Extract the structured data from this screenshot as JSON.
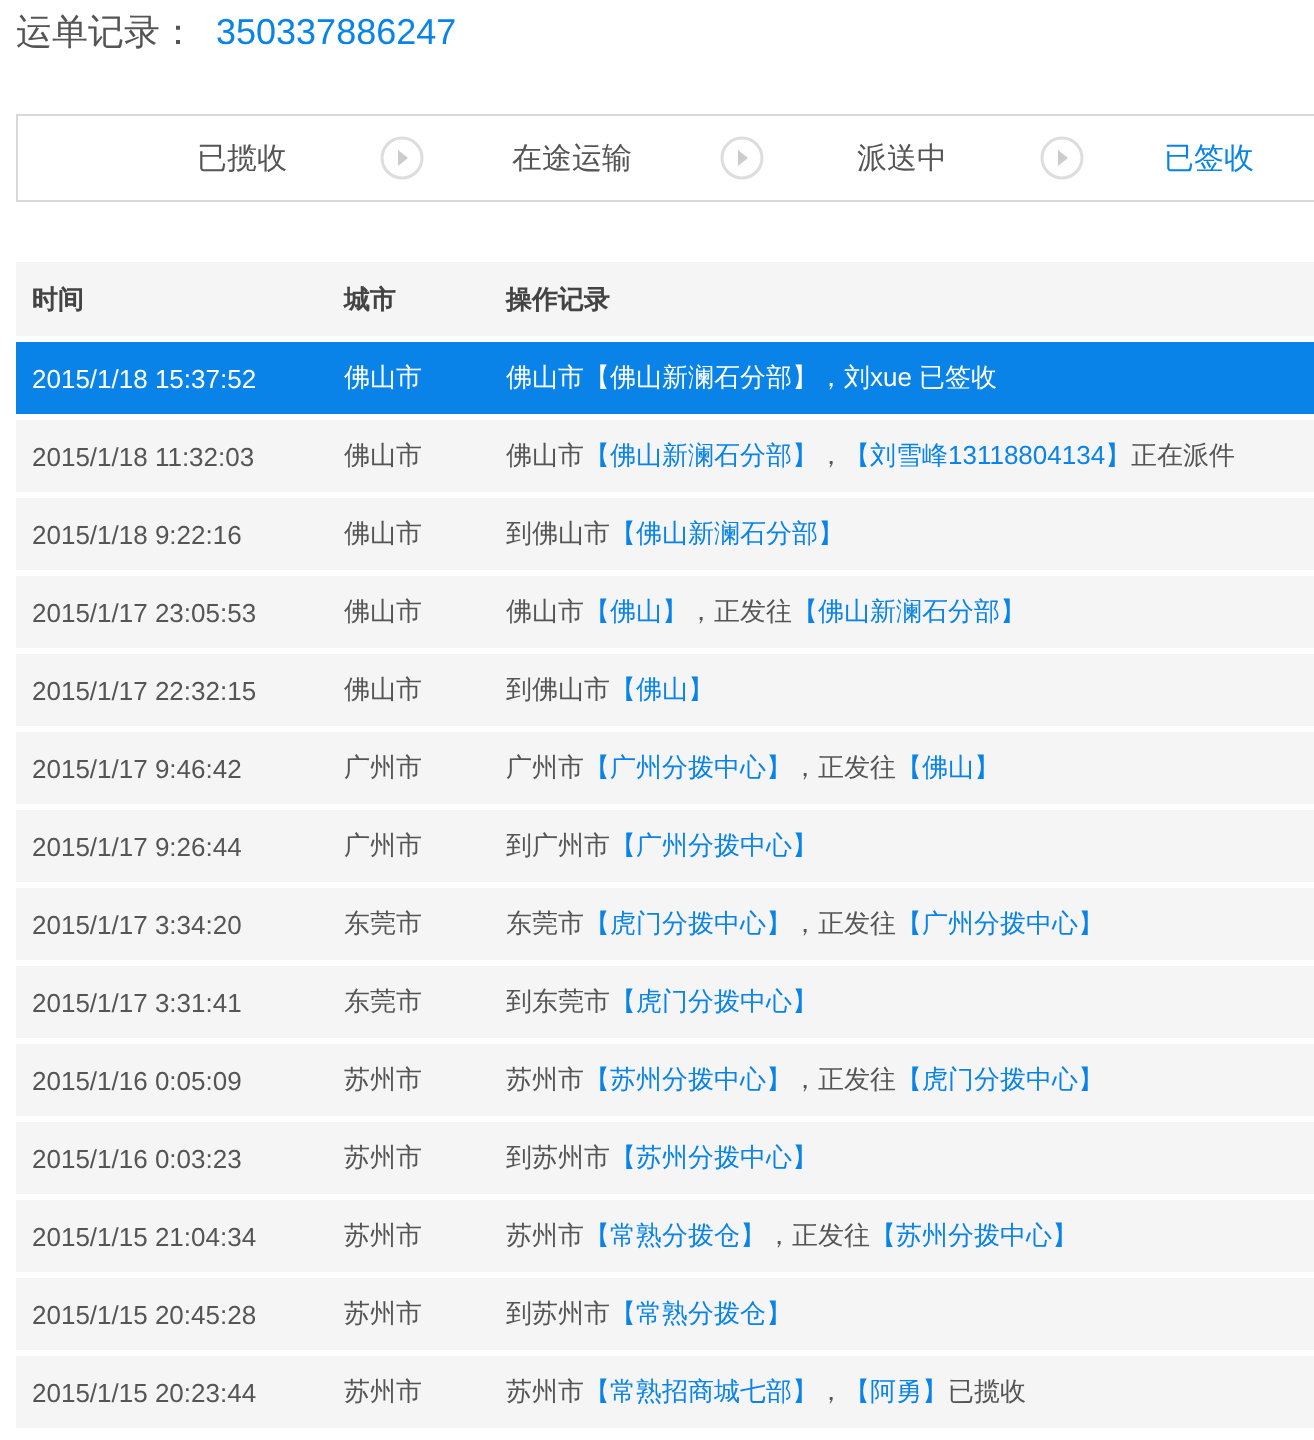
{
  "header": {
    "label": "运单记录：",
    "tracking_number": "350337886247"
  },
  "steps": [
    {
      "label": "已揽收",
      "selected": false
    },
    {
      "label": "在途运输",
      "selected": false
    },
    {
      "label": "派送中",
      "selected": false
    },
    {
      "label": "已签收",
      "selected": true
    }
  ],
  "table": {
    "columns": [
      "时间",
      "城市",
      "操作记录"
    ],
    "rows": [
      {
        "time": "2015/1/18 15:37:52",
        "city": "佛山市",
        "selected": true,
        "record": [
          {
            "text": "佛山市【佛山新澜石分部】，刘xue 已签收"
          }
        ]
      },
      {
        "time": "2015/1/18 11:32:03",
        "city": "佛山市",
        "selected": false,
        "record": [
          {
            "text": "佛山市",
            "highlight": false
          },
          {
            "text": "【佛山新澜石分部】",
            "highlight": true
          },
          {
            "text": "，",
            "highlight": false
          },
          {
            "text": "【刘雪峰13118804134】",
            "highlight": true
          },
          {
            "text": "正在派件",
            "highlight": false
          }
        ]
      },
      {
        "time": "2015/1/18 9:22:16",
        "city": "佛山市",
        "selected": false,
        "record": [
          {
            "text": "到佛山市",
            "highlight": false
          },
          {
            "text": "【佛山新澜石分部】",
            "highlight": true
          }
        ]
      },
      {
        "time": "2015/1/17 23:05:53",
        "city": "佛山市",
        "selected": false,
        "record": [
          {
            "text": "佛山市",
            "highlight": false
          },
          {
            "text": "【佛山】",
            "highlight": true
          },
          {
            "text": "，正发往",
            "highlight": false
          },
          {
            "text": "【佛山新澜石分部】",
            "highlight": true
          }
        ]
      },
      {
        "time": "2015/1/17 22:32:15",
        "city": "佛山市",
        "selected": false,
        "record": [
          {
            "text": "到佛山市",
            "highlight": false
          },
          {
            "text": "【佛山】",
            "highlight": true
          }
        ]
      },
      {
        "time": "2015/1/17 9:46:42",
        "city": "广州市",
        "selected": false,
        "record": [
          {
            "text": "广州市",
            "highlight": false
          },
          {
            "text": "【广州分拨中心】",
            "highlight": true
          },
          {
            "text": "，正发往",
            "highlight": false
          },
          {
            "text": "【佛山】",
            "highlight": true
          }
        ]
      },
      {
        "time": "2015/1/17 9:26:44",
        "city": "广州市",
        "selected": false,
        "record": [
          {
            "text": "到广州市",
            "highlight": false
          },
          {
            "text": "【广州分拨中心】",
            "highlight": true
          }
        ]
      },
      {
        "time": "2015/1/17 3:34:20",
        "city": "东莞市",
        "selected": false,
        "record": [
          {
            "text": "东莞市",
            "highlight": false
          },
          {
            "text": "【虎门分拨中心】",
            "highlight": true
          },
          {
            "text": "，正发往",
            "highlight": false
          },
          {
            "text": "【广州分拨中心】",
            "highlight": true
          }
        ]
      },
      {
        "time": "2015/1/17 3:31:41",
        "city": "东莞市",
        "selected": false,
        "record": [
          {
            "text": "到东莞市",
            "highlight": false
          },
          {
            "text": "【虎门分拨中心】",
            "highlight": true
          }
        ]
      },
      {
        "time": "2015/1/16 0:05:09",
        "city": "苏州市",
        "selected": false,
        "record": [
          {
            "text": "苏州市",
            "highlight": false
          },
          {
            "text": "【苏州分拨中心】",
            "highlight": true
          },
          {
            "text": "，正发往",
            "highlight": false
          },
          {
            "text": "【虎门分拨中心】",
            "highlight": true
          }
        ]
      },
      {
        "time": "2015/1/16 0:03:23",
        "city": "苏州市",
        "selected": false,
        "record": [
          {
            "text": "到苏州市",
            "highlight": false
          },
          {
            "text": "【苏州分拨中心】",
            "highlight": true
          }
        ]
      },
      {
        "time": "2015/1/15 21:04:34",
        "city": "苏州市",
        "selected": false,
        "record": [
          {
            "text": "苏州市",
            "highlight": false
          },
          {
            "text": "【常熟分拨仓】",
            "highlight": true
          },
          {
            "text": "，正发往",
            "highlight": false
          },
          {
            "text": "【苏州分拨中心】",
            "highlight": true
          }
        ]
      },
      {
        "time": "2015/1/15 20:45:28",
        "city": "苏州市",
        "selected": false,
        "record": [
          {
            "text": "到苏州市",
            "highlight": false
          },
          {
            "text": "【常熟分拨仓】",
            "highlight": true
          }
        ]
      },
      {
        "time": "2015/1/15 20:23:44",
        "city": "苏州市",
        "selected": false,
        "record": [
          {
            "text": "苏州市",
            "highlight": false
          },
          {
            "text": "【常熟招商城七部】",
            "highlight": true
          },
          {
            "text": "，",
            "highlight": false
          },
          {
            "text": "【阿勇】",
            "highlight": true
          },
          {
            "text": "已揽收",
            "highlight": false
          }
        ]
      }
    ]
  }
}
